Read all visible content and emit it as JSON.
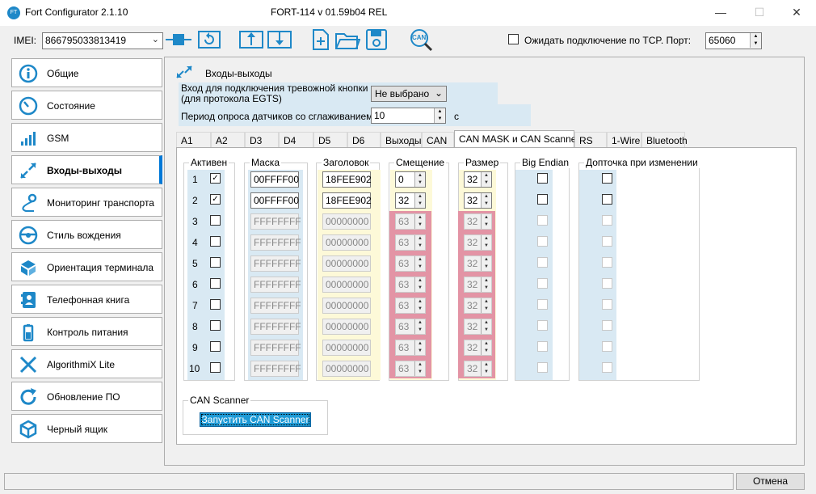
{
  "window": {
    "app_title": "Fort Configurator 2.1.10",
    "app_icon_text": "FT",
    "device_title": "FORT-114 v 01.59b04 REL",
    "minimize": "—",
    "maximize": "☐",
    "close": "✕"
  },
  "toolbar": {
    "imei_label": "IMEI:",
    "imei_value": "866795033813419",
    "tcp_wait_label": "Ожидать подключение по TCP. Порт:",
    "tcp_wait_checked": false,
    "port_value": "65060",
    "can_icon_text": "CAN"
  },
  "sidebar": {
    "items": [
      {
        "label": "Общие",
        "icon": "info-icon"
      },
      {
        "label": "Состояние",
        "icon": "gauge-icon"
      },
      {
        "label": "GSM",
        "icon": "signal-icon"
      },
      {
        "label": "Входы-выходы",
        "icon": "arrows-io-icon"
      },
      {
        "label": "Мониторинг транспорта",
        "icon": "route-icon"
      },
      {
        "label": "Стиль вождения",
        "icon": "steering-icon"
      },
      {
        "label": "Ориентация терминала",
        "icon": "cube-orientation-icon"
      },
      {
        "label": "Телефонная книга",
        "icon": "contacts-icon"
      },
      {
        "label": "Контроль питания",
        "icon": "battery-icon"
      },
      {
        "label": "AlgorithmiX Lite",
        "icon": "algorithmix-icon"
      },
      {
        "label": "Обновление ПО",
        "icon": "update-icon"
      },
      {
        "label": "Черный ящик",
        "icon": "blackbox-icon"
      }
    ],
    "active_index": 3
  },
  "main": {
    "title": "Входы-выходы",
    "alarm_label_line1": "Вход для подключения тревожной кнопки",
    "alarm_label_line2": "(для протокола EGTS)",
    "alarm_value": "Не выбрано",
    "period_label": "Период опроса датчиков со сглаживанием",
    "period_value": "10",
    "period_unit": "с",
    "tabs": [
      "A1",
      "A2",
      "D3",
      "D4",
      "D5",
      "D6",
      "Выходы",
      "CAN",
      "CAN MASK и CAN Scanner",
      "RS",
      "1-Wire",
      "Bluetooth"
    ],
    "active_tab": 8
  },
  "canmask": {
    "headers": {
      "active": "Активен",
      "mask": "Маска",
      "header": "Заголовок",
      "offset": "Смещение",
      "size": "Размер",
      "big_endian": "Big Endian",
      "on_change": "Допточка при изменении"
    },
    "rows": [
      {
        "n": "1",
        "active": true,
        "enabled": true,
        "mask": "00FFFF00",
        "header": "18FEE902",
        "offset": "0",
        "size": "32",
        "big_endian": false,
        "on_change": false
      },
      {
        "n": "2",
        "active": true,
        "enabled": true,
        "mask": "00FFFF00",
        "header": "18FEE902",
        "offset": "32",
        "size": "32",
        "big_endian": false,
        "on_change": false
      },
      {
        "n": "3",
        "active": false,
        "enabled": false,
        "mask": "FFFFFFFF",
        "header": "00000000",
        "offset": "63",
        "size": "32",
        "big_endian": false,
        "on_change": false
      },
      {
        "n": "4",
        "active": false,
        "enabled": false,
        "mask": "FFFFFFFF",
        "header": "00000000",
        "offset": "63",
        "size": "32",
        "big_endian": false,
        "on_change": false
      },
      {
        "n": "5",
        "active": false,
        "enabled": false,
        "mask": "FFFFFFFF",
        "header": "00000000",
        "offset": "63",
        "size": "32",
        "big_endian": false,
        "on_change": false
      },
      {
        "n": "6",
        "active": false,
        "enabled": false,
        "mask": "FFFFFFFF",
        "header": "00000000",
        "offset": "63",
        "size": "32",
        "big_endian": false,
        "on_change": false
      },
      {
        "n": "7",
        "active": false,
        "enabled": false,
        "mask": "FFFFFFFF",
        "header": "00000000",
        "offset": "63",
        "size": "32",
        "big_endian": false,
        "on_change": false
      },
      {
        "n": "8",
        "active": false,
        "enabled": false,
        "mask": "FFFFFFFF",
        "header": "00000000",
        "offset": "63",
        "size": "32",
        "big_endian": false,
        "on_change": false
      },
      {
        "n": "9",
        "active": false,
        "enabled": false,
        "mask": "FFFFFFFF",
        "header": "00000000",
        "offset": "63",
        "size": "32",
        "big_endian": false,
        "on_change": false
      },
      {
        "n": "10",
        "active": false,
        "enabled": false,
        "mask": "FFFFFFFF",
        "header": "00000000",
        "offset": "63",
        "size": "32",
        "big_endian": false,
        "on_change": false
      }
    ],
    "scanner_group": "CAN Scanner",
    "scanner_button": "Запустить CAN Scanner"
  },
  "footer": {
    "cancel_button": "Отмена"
  },
  "colors": {
    "accent": "#0078d7",
    "light_blue": "#d9e9f3",
    "light_yellow": "#fdf9d8",
    "pink": "#e394a5",
    "button_blue": "#1e9ad6"
  }
}
